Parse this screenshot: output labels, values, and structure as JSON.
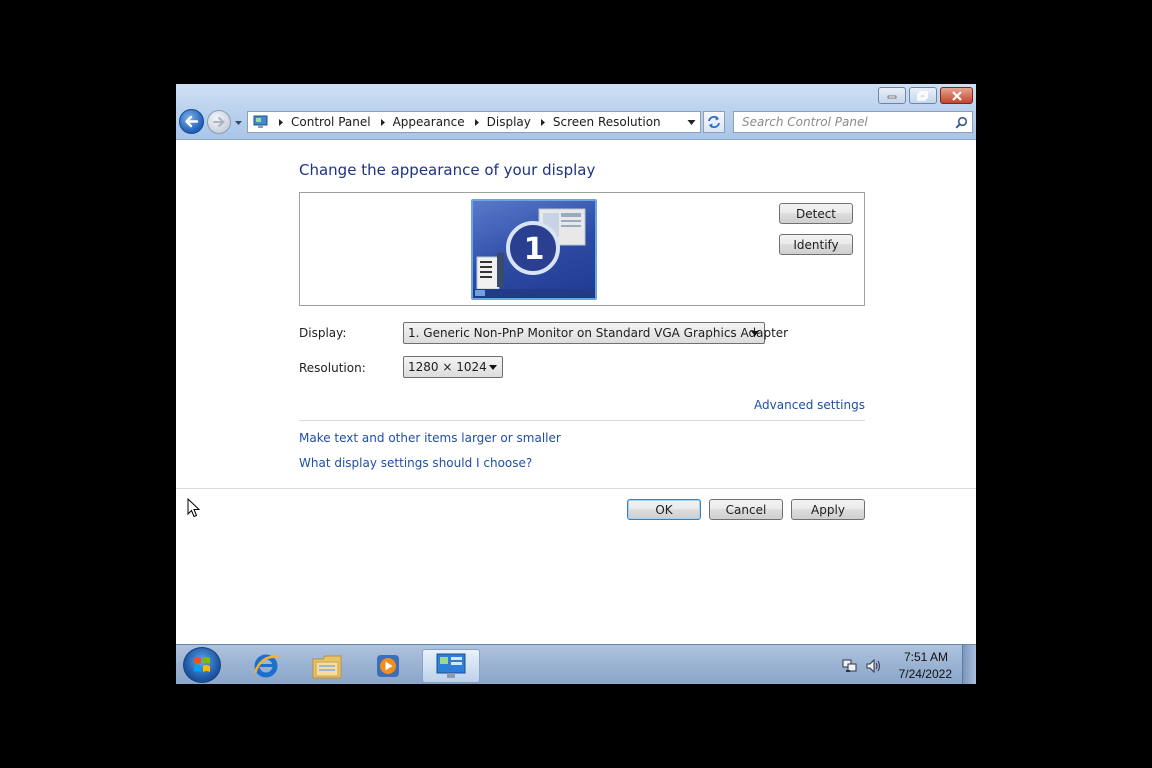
{
  "window": {
    "caption_buttons": [
      "minimize",
      "maximize",
      "close"
    ]
  },
  "address_bar": {
    "breadcrumbs": [
      "Control Panel",
      "Appearance",
      "Display",
      "Screen Resolution"
    ]
  },
  "search": {
    "placeholder": "Search Control Panel"
  },
  "main": {
    "title": "Change the appearance of your display",
    "monitor_number": "1",
    "detect_label": "Detect",
    "identify_label": "Identify",
    "display_label": "Display:",
    "display_value": "1. Generic Non-PnP Monitor on Standard VGA Graphics Adapter",
    "resolution_label": "Resolution:",
    "resolution_value": "1280 × 1024",
    "advanced_link": "Advanced settings",
    "text_size_link": "Make text and other items larger or smaller",
    "choose_link": "What display settings should I choose?",
    "ok_label": "OK",
    "cancel_label": "Cancel",
    "apply_label": "Apply"
  },
  "taskbar": {
    "pinned": [
      "internet-explorer-icon",
      "windows-explorer-icon",
      "media-player-icon",
      "control-panel-icon"
    ],
    "clock_time": "7:51 AM",
    "clock_date": "7/24/2022"
  },
  "colors": {
    "title_text": "#1e3287",
    "link": "#1f4ea8",
    "glass": "#bcd3ee",
    "taskbar": "#9bb3d3",
    "close_button": "#c3452c"
  }
}
